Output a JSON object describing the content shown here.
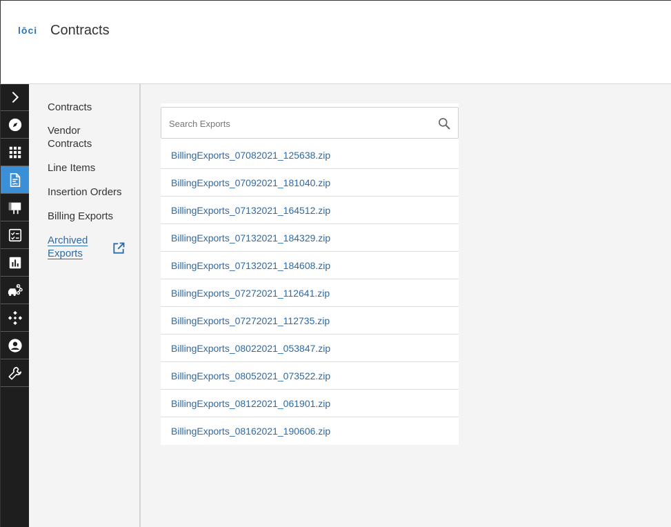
{
  "header": {
    "logo_text": "lōci",
    "title": "Contracts"
  },
  "rail": {
    "items": [
      {
        "icon": "chevron-right-icon",
        "active": false
      },
      {
        "icon": "compass-icon",
        "active": false
      },
      {
        "icon": "grid-icon",
        "active": false
      },
      {
        "icon": "contract-document-icon",
        "active": true
      },
      {
        "icon": "billboard-icon",
        "active": false
      },
      {
        "icon": "checklist-icon",
        "active": false
      },
      {
        "icon": "bar-chart-icon",
        "active": false
      },
      {
        "icon": "vehicles-network-icon",
        "active": false
      },
      {
        "icon": "diamond-nodes-icon",
        "active": false
      },
      {
        "icon": "user-circle-icon",
        "active": false
      },
      {
        "icon": "wrench-icon",
        "active": false
      }
    ],
    "active_color": "#3a8fd6"
  },
  "subnav": {
    "contracts": "Contracts",
    "vendor_contracts_line1": "Vendor",
    "vendor_contracts_line2": "Contracts",
    "line_items": "Line Items",
    "insertion_orders": "Insertion Orders",
    "billing_exports": "Billing Exports",
    "archived_exports_line1": "Archived",
    "archived_exports_line2": "Exports"
  },
  "search": {
    "placeholder": "Search Exports",
    "value": ""
  },
  "exports": [
    "BillingExports_07082021_125638.zip",
    "BillingExports_07092021_181040.zip",
    "BillingExports_07132021_164512.zip",
    "BillingExports_07132021_184329.zip",
    "BillingExports_07132021_184608.zip",
    "BillingExports_07272021_112641.zip",
    "BillingExports_07272021_112735.zip",
    "BillingExports_08022021_053847.zip",
    "BillingExports_08052021_073522.zip",
    "BillingExports_08122021_061901.zip",
    "BillingExports_08162021_190606.zip"
  ],
  "colors": {
    "link": "#2b6aa6",
    "rail_bg": "#1e1e1e"
  }
}
